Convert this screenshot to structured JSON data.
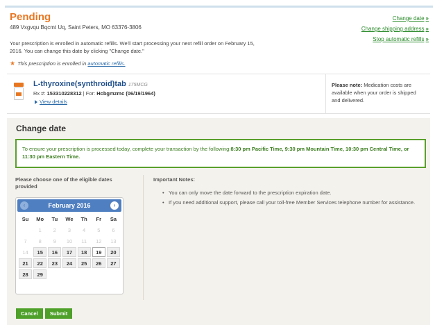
{
  "pending": {
    "title": "Pending",
    "address": "489 Vxgvqu Bqcmt Uq, Saint Peters, MO 63376-3806",
    "message": "Your prescription is enrolled in automatic refills. We'll start processing your next refill order on February 15, 2016. You can change this date by clicking \"Change date.\"",
    "enrolled_prefix": "This prescription is enrolled in",
    "enrolled_link": "automatic refills.",
    "actions": [
      "Change date",
      "Change shipping address",
      "Stop automatic refills"
    ],
    "chevron": "»"
  },
  "rx": {
    "name": "L-thyroxine(synthroid)tab",
    "dose": "175MCG",
    "rx_label": "Rx #:",
    "rx_number": "153310228312",
    "for_label": "| For:",
    "patient": "Hcbgmzmc (06/19/1964)",
    "details": "View details",
    "note_bold": "Please note:",
    "note_text": "Medication costs are available when your order is shipped and delivered."
  },
  "change": {
    "title": "Change date",
    "banner_text": "To ensure your prescription is processed today, complete your transaction by the following:",
    "banner_bold": "8:30 pm Pacific Time, 9:30 pm Mountain Time, 10:30 pm Central Time, or 11:30 pm Eastern Time.",
    "choose_label": "Please choose one of the eligible dates provided",
    "notes_heading": "Important Notes:",
    "notes": [
      "You can only move the date forward to the prescription expiration date.",
      "If you need additional support, please call your toll-free Member Services telephone number for assistance."
    ]
  },
  "calendar": {
    "month": "February 2016",
    "prev": "‹",
    "next": "›",
    "weekdays": [
      "Su",
      "Mo",
      "Tu",
      "We",
      "Th",
      "Fr",
      "Sa"
    ],
    "weeks": [
      [
        "",
        "1",
        "2",
        "3",
        "4",
        "5",
        "6"
      ],
      [
        "7",
        "8",
        "9",
        "10",
        "11",
        "12",
        "13"
      ],
      [
        "14",
        "15",
        "16",
        "17",
        "18",
        "19",
        "20"
      ],
      [
        "21",
        "22",
        "23",
        "24",
        "25",
        "26",
        "27"
      ],
      [
        "28",
        "29",
        "",
        "",
        "",
        "",
        ""
      ]
    ],
    "first_eligible": 15,
    "selected": 19
  },
  "buttons": {
    "cancel": "Cancel",
    "submit": "Submit"
  },
  "colors": {
    "accent_orange": "#e87722",
    "link_green": "#2a8a2a",
    "banner_green": "#5aa02c",
    "calendar_blue": "#4f7fc0",
    "button_green": "#4ea02a"
  }
}
